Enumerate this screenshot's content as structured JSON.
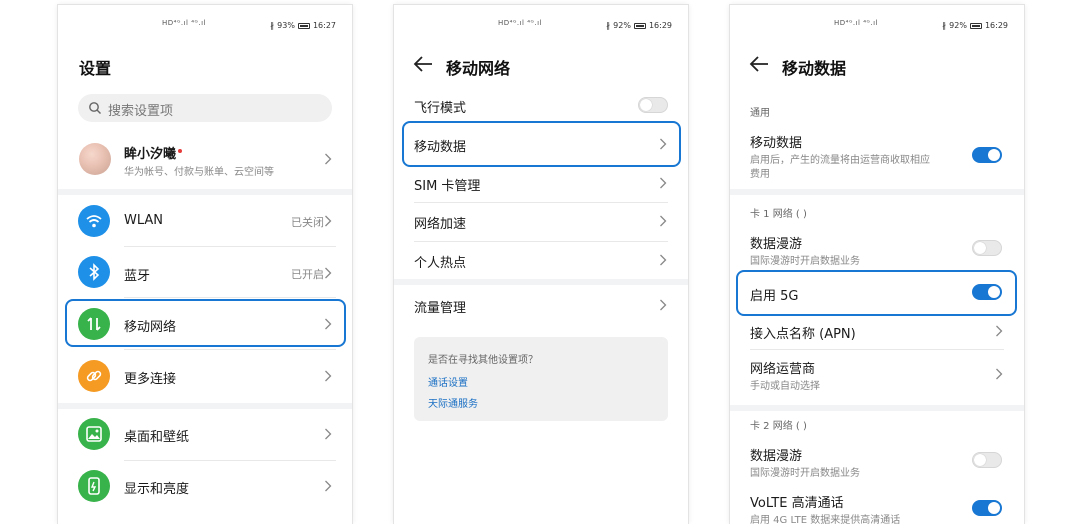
{
  "status1": {
    "signal": "HD⁴ᴳ.ıl ⁴ᴳ.ıl",
    "battery": "93%",
    "time": "16:27"
  },
  "status2": {
    "signal": "HD⁴ᴳ.ıl ⁴ᴳ.ıl",
    "battery": "92%",
    "time": "16:29"
  },
  "status3": {
    "signal": "HD⁴ᴳ.ıl ⁴ᴳ.ıl",
    "battery": "92%",
    "time": "16:29"
  },
  "settings": {
    "title": "设置",
    "search_placeholder": "搜索设置项",
    "account": {
      "name": "眸小汐曦",
      "subtitle": "华为帐号、付款与账单、云空间等"
    },
    "items": [
      {
        "label": "WLAN",
        "status": "已关闭",
        "icon": "wifi-icon",
        "color": "#1e90e8"
      },
      {
        "label": "蓝牙",
        "status": "已开启",
        "icon": "bluetooth-icon",
        "color": "#1e90e8"
      },
      {
        "label": "移动网络",
        "status": "",
        "icon": "mobile-data-icon",
        "color": "#38b24a"
      },
      {
        "label": "更多连接",
        "status": "",
        "icon": "link-icon",
        "color": "#f59a23"
      },
      {
        "label": "桌面和壁纸",
        "status": "",
        "icon": "wallpaper-icon",
        "color": "#38b24a"
      },
      {
        "label": "显示和亮度",
        "status": "",
        "icon": "display-icon",
        "color": "#38b24a"
      }
    ]
  },
  "mobile_network": {
    "title": "移动网络",
    "items": [
      "飞行模式",
      "移动数据",
      "SIM 卡管理",
      "网络加速",
      "个人热点",
      "流量管理"
    ],
    "airplane_mode": false,
    "tips_question": "是否在寻找其他设置项？",
    "tips_links": [
      "通话设置",
      "天际通服务"
    ]
  },
  "mobile_data": {
    "title": "移动数据",
    "section_general": "通用",
    "mobile_data_label": "移动数据",
    "mobile_data_desc_1": "启用后，产生的流量将由运营商收取相应",
    "mobile_data_desc_2": "费用",
    "mobile_data_on": true,
    "sim1_label": "卡 1 网络 (                    )",
    "roaming_label": "数据漫游",
    "roaming_desc": "国际漫游时开启数据业务",
    "roaming1_on": false,
    "enable5g_label": "启用 5G",
    "enable5g_on": true,
    "apn_label": "接入点名称 (APN)",
    "carrier_label": "网络运营商",
    "carrier_desc": "手动或自动选择",
    "sim2_label": "卡 2 网络 (                    )",
    "roaming2_label": "数据漫游",
    "roaming2_desc": "国际漫游时开启数据业务",
    "roaming2_on": false,
    "volte_label": "VoLTE 高清通话",
    "volte_desc": "启用 4G LTE 数据来提供高清通话",
    "volte_on": true
  },
  "colors": {
    "accent": "#1877d2",
    "highlight": "#1877d2",
    "green": "#38b24a",
    "blue": "#1e90e8",
    "orange": "#f59a23"
  }
}
